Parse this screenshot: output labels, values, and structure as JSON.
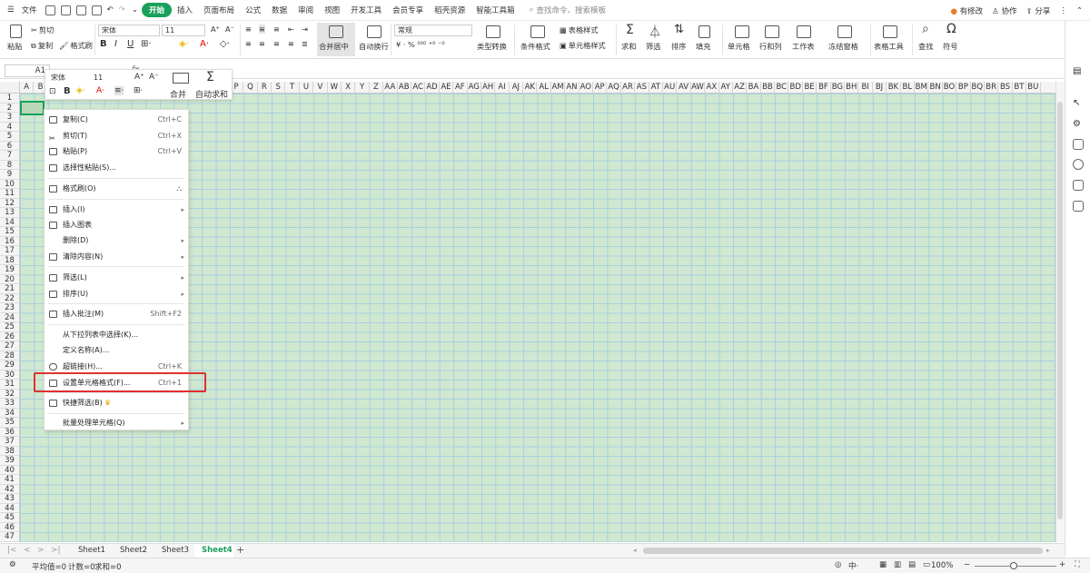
{
  "menubar": {
    "file": "文件",
    "tabs": [
      "开始",
      "插入",
      "页面布局",
      "公式",
      "数据",
      "审阅",
      "视图",
      "开发工具",
      "会员专享",
      "稻壳资源",
      "智能工具箱"
    ],
    "active_tab": "开始",
    "search_placeholder": "查找命令、搜索模板",
    "right": {
      "changes": "有修改",
      "collab": "协作",
      "share": "分享"
    }
  },
  "ribbon": {
    "paste": "粘贴",
    "cut": "剪切",
    "copy": "复制",
    "format_painter": "格式刷",
    "font_name": "宋体",
    "font_size": "11",
    "bold": "B",
    "italic": "I",
    "underline": "U",
    "merge_center": "合并居中",
    "wrap": "自动换行",
    "number_format": "常规",
    "number_symbols": "¥ · % ⁰⁰⁰ ⁺⁰ ⁻⁰",
    "type_convert": "类型转换",
    "cond_format": "条件格式",
    "table_style": "表格样式",
    "cell_style": "单元格样式",
    "sum": "求和",
    "filter": "筛选",
    "sort": "排序",
    "fill": "填充",
    "cell": "单元格",
    "rowcol": "行和列",
    "sheet": "工作表",
    "freeze": "冻结窗格",
    "table_tools": "表格工具",
    "find": "查找",
    "symbol": "符号"
  },
  "formula_bar": {
    "name_box": "A1",
    "fx": "fx"
  },
  "mini_toolbar": {
    "font_name": "宋体",
    "font_size": "11",
    "grow": "A⁺",
    "shrink": "A⁻",
    "bold": "B",
    "merge": "合并",
    "autosum": "自动求和"
  },
  "columns": [
    "A",
    "B",
    "C",
    "D",
    "E",
    "F",
    "G",
    "H",
    "I",
    "J",
    "K",
    "L",
    "M",
    "N",
    "O",
    "P",
    "Q",
    "R",
    "S",
    "T",
    "U",
    "V",
    "W",
    "X",
    "Y",
    "Z",
    "AA",
    "AB",
    "AC",
    "AD",
    "AE",
    "AF",
    "AG",
    "AH",
    "AI",
    "AJ",
    "AK",
    "AL",
    "AM",
    "AN",
    "AO",
    "AP",
    "AQ",
    "AR",
    "AS",
    "AT",
    "AU",
    "AV",
    "AW",
    "AX",
    "AY",
    "AZ",
    "BA",
    "BB",
    "BC",
    "BD",
    "BE",
    "BF",
    "BG",
    "BH",
    "BI",
    "BJ",
    "BK",
    "BL",
    "BM",
    "BN",
    "BO",
    "BP",
    "BQ",
    "BR",
    "BS",
    "BT",
    "BU"
  ],
  "rows": [
    "1",
    "2",
    "3",
    "4",
    "5",
    "6",
    "7",
    "8",
    "9",
    "10",
    "11",
    "12",
    "13",
    "14",
    "15",
    "16",
    "17",
    "18",
    "19",
    "20",
    "21",
    "22",
    "23",
    "24",
    "25",
    "26",
    "27",
    "28",
    "29",
    "30",
    "31",
    "32",
    "33",
    "34",
    "35",
    "36",
    "37",
    "38",
    "39",
    "40",
    "41",
    "42",
    "43",
    "44",
    "45",
    "46",
    "47"
  ],
  "context_menu": {
    "copy": {
      "label": "复制(C)",
      "shortcut": "Ctrl+C"
    },
    "cut": {
      "label": "剪切(T)",
      "shortcut": "Ctrl+X"
    },
    "paste": {
      "label": "粘贴(P)",
      "shortcut": "Ctrl+V"
    },
    "paste_special": {
      "label": "选择性粘贴(S)..."
    },
    "format_painter": {
      "label": "格式刷(O)"
    },
    "insert": {
      "label": "插入(I)"
    },
    "insert_chart": {
      "label": "插入图表"
    },
    "delete": {
      "label": "删除(D)"
    },
    "clear": {
      "label": "清除内容(N)"
    },
    "filter": {
      "label": "筛选(L)"
    },
    "sort": {
      "label": "排序(U)"
    },
    "comment": {
      "label": "插入批注(M)",
      "shortcut": "Shift+F2"
    },
    "pick_list": {
      "label": "从下拉列表中选择(K)..."
    },
    "define_name": {
      "label": "定义名称(A)..."
    },
    "hyperlink": {
      "label": "超链接(H)...",
      "shortcut": "Ctrl+K"
    },
    "format_cells": {
      "label": "设置单元格格式(F)...",
      "shortcut": "Ctrl+1"
    },
    "quick_filter": {
      "label": "快捷筛选(B)"
    },
    "batch": {
      "label": "批量处理单元格(Q)"
    }
  },
  "sheets": [
    "Sheet1",
    "Sheet2",
    "Sheet3",
    "Sheet4"
  ],
  "active_sheet": "Sheet4",
  "status": {
    "avg": "平均值=0",
    "count": "计数=0",
    "sum": "求和=0",
    "zoom": "100%"
  },
  "colors": {
    "accent": "#1aa05b",
    "grid_bg": "#cfe8cf",
    "highlight": "#e03030"
  }
}
